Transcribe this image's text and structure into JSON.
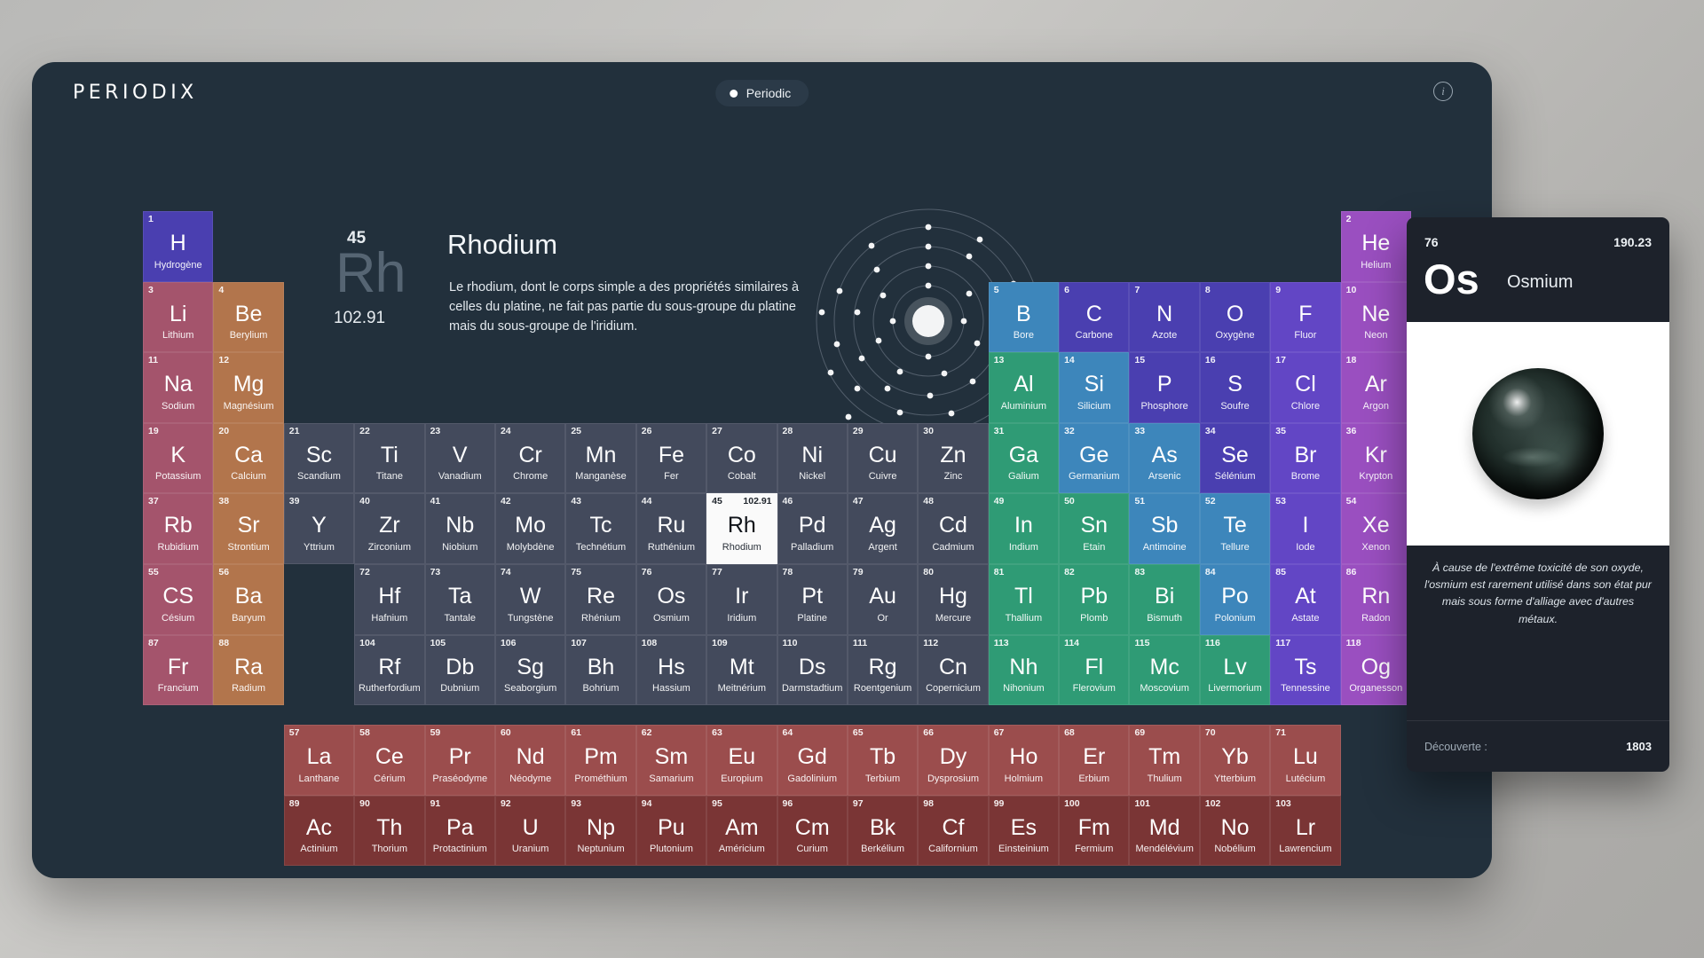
{
  "header": {
    "brand": "PERIODIX",
    "mode_label": "Periodic",
    "info_icon": "info-circle-icon"
  },
  "detail": {
    "number": "45",
    "symbol": "Rh",
    "mass": "102.91",
    "name": "Rhodium",
    "description": "Le rhodium, dont le corps simple a des propriétés similaires à celles du platine, ne fait pas partie du sous-groupe du platine mais du sous-groupe de l'iridium."
  },
  "card": {
    "number": "76",
    "mass": "190.23",
    "symbol": "Os",
    "name": "Osmium",
    "description": "À cause de l'extrême toxicité de son oxyde, l'osmium est rarement utilisé dans son état pur mais sous forme d'alliage avec d'autres métaux.",
    "discovery_label": "Découverte :",
    "discovery_value": "1803",
    "image_alt": "osmium-sphere-photo"
  },
  "colors": {
    "bg_app": "#22303c",
    "alkali": "#a4546c",
    "alkaline_earth": "#b2754c",
    "transition": "#434a5c",
    "post_transition": "#2f9b75",
    "metalloid": "#3d86bb",
    "nonmetal": "#4a3fb0",
    "halogen": "#6246c5",
    "noble": "#9a4fc0",
    "lanthanide": "#9b4d4d",
    "actinide": "#7a3535",
    "selected": "#fafafa"
  },
  "elements": [
    {
      "n": "1",
      "s": "H",
      "name": "Hydrogène",
      "g": "nonmetal",
      "r": 1,
      "c": 1
    },
    {
      "n": "2",
      "s": "He",
      "name": "Helium",
      "g": "noble",
      "r": 1,
      "c": 18
    },
    {
      "n": "3",
      "s": "Li",
      "name": "Lithium",
      "g": "alkali",
      "r": 2,
      "c": 1
    },
    {
      "n": "4",
      "s": "Be",
      "name": "Berylium",
      "g": "alkaline_earth",
      "r": 2,
      "c": 2
    },
    {
      "n": "5",
      "s": "B",
      "name": "Bore",
      "g": "metalloid",
      "r": 2,
      "c": 13
    },
    {
      "n": "6",
      "s": "C",
      "name": "Carbone",
      "g": "nonmetal",
      "r": 2,
      "c": 14
    },
    {
      "n": "7",
      "s": "N",
      "name": "Azote",
      "g": "nonmetal",
      "r": 2,
      "c": 15
    },
    {
      "n": "8",
      "s": "O",
      "name": "Oxygène",
      "g": "nonmetal",
      "r": 2,
      "c": 16
    },
    {
      "n": "9",
      "s": "F",
      "name": "Fluor",
      "g": "halogen",
      "r": 2,
      "c": 17
    },
    {
      "n": "10",
      "s": "Ne",
      "name": "Neon",
      "g": "noble",
      "r": 2,
      "c": 18
    },
    {
      "n": "11",
      "s": "Na",
      "name": "Sodium",
      "g": "alkali",
      "r": 3,
      "c": 1
    },
    {
      "n": "12",
      "s": "Mg",
      "name": "Magnésium",
      "g": "alkaline_earth",
      "r": 3,
      "c": 2
    },
    {
      "n": "13",
      "s": "Al",
      "name": "Aluminium",
      "g": "post_transition",
      "r": 3,
      "c": 13
    },
    {
      "n": "14",
      "s": "Si",
      "name": "Silicium",
      "g": "metalloid",
      "r": 3,
      "c": 14
    },
    {
      "n": "15",
      "s": "P",
      "name": "Phosphore",
      "g": "nonmetal",
      "r": 3,
      "c": 15
    },
    {
      "n": "16",
      "s": "S",
      "name": "Soufre",
      "g": "nonmetal",
      "r": 3,
      "c": 16
    },
    {
      "n": "17",
      "s": "Cl",
      "name": "Chlore",
      "g": "halogen",
      "r": 3,
      "c": 17
    },
    {
      "n": "18",
      "s": "Ar",
      "name": "Argon",
      "g": "noble",
      "r": 3,
      "c": 18
    },
    {
      "n": "19",
      "s": "K",
      "name": "Potassium",
      "g": "alkali",
      "r": 4,
      "c": 1
    },
    {
      "n": "20",
      "s": "Ca",
      "name": "Calcium",
      "g": "alkaline_earth",
      "r": 4,
      "c": 2
    },
    {
      "n": "21",
      "s": "Sc",
      "name": "Scandium",
      "g": "transition",
      "r": 4,
      "c": 3
    },
    {
      "n": "22",
      "s": "Ti",
      "name": "Titane",
      "g": "transition",
      "r": 4,
      "c": 4
    },
    {
      "n": "23",
      "s": "V",
      "name": "Vanadium",
      "g": "transition",
      "r": 4,
      "c": 5
    },
    {
      "n": "24",
      "s": "Cr",
      "name": "Chrome",
      "g": "transition",
      "r": 4,
      "c": 6
    },
    {
      "n": "25",
      "s": "Mn",
      "name": "Manganèse",
      "g": "transition",
      "r": 4,
      "c": 7
    },
    {
      "n": "26",
      "s": "Fe",
      "name": "Fer",
      "g": "transition",
      "r": 4,
      "c": 8
    },
    {
      "n": "27",
      "s": "Co",
      "name": "Cobalt",
      "g": "transition",
      "r": 4,
      "c": 9
    },
    {
      "n": "28",
      "s": "Ni",
      "name": "Nickel",
      "g": "transition",
      "r": 4,
      "c": 10
    },
    {
      "n": "29",
      "s": "Cu",
      "name": "Cuivre",
      "g": "transition",
      "r": 4,
      "c": 11
    },
    {
      "n": "30",
      "s": "Zn",
      "name": "Zinc",
      "g": "transition",
      "r": 4,
      "c": 12
    },
    {
      "n": "31",
      "s": "Ga",
      "name": "Galium",
      "g": "post_transition",
      "r": 4,
      "c": 13
    },
    {
      "n": "32",
      "s": "Ge",
      "name": "Germanium",
      "g": "metalloid",
      "r": 4,
      "c": 14
    },
    {
      "n": "33",
      "s": "As",
      "name": "Arsenic",
      "g": "metalloid",
      "r": 4,
      "c": 15
    },
    {
      "n": "34",
      "s": "Se",
      "name": "Sélénium",
      "g": "nonmetal",
      "r": 4,
      "c": 16
    },
    {
      "n": "35",
      "s": "Br",
      "name": "Brome",
      "g": "halogen",
      "r": 4,
      "c": 17
    },
    {
      "n": "36",
      "s": "Kr",
      "name": "Krypton",
      "g": "noble",
      "r": 4,
      "c": 18
    },
    {
      "n": "37",
      "s": "Rb",
      "name": "Rubidium",
      "g": "alkali",
      "r": 5,
      "c": 1
    },
    {
      "n": "38",
      "s": "Sr",
      "name": "Strontium",
      "g": "alkaline_earth",
      "r": 5,
      "c": 2
    },
    {
      "n": "39",
      "s": "Y",
      "name": "Yttrium",
      "g": "transition",
      "r": 5,
      "c": 3
    },
    {
      "n": "40",
      "s": "Zr",
      "name": "Zirconium",
      "g": "transition",
      "r": 5,
      "c": 4
    },
    {
      "n": "41",
      "s": "Nb",
      "name": "Niobium",
      "g": "transition",
      "r": 5,
      "c": 5
    },
    {
      "n": "42",
      "s": "Mo",
      "name": "Molybdène",
      "g": "transition",
      "r": 5,
      "c": 6
    },
    {
      "n": "43",
      "s": "Tc",
      "name": "Technétium",
      "g": "transition",
      "r": 5,
      "c": 7
    },
    {
      "n": "44",
      "s": "Ru",
      "name": "Ruthénium",
      "g": "transition",
      "r": 5,
      "c": 8
    },
    {
      "n": "45",
      "s": "Rh",
      "name": "Rhodium",
      "g": "transition",
      "r": 5,
      "c": 9,
      "mass": "102.91",
      "selected": true
    },
    {
      "n": "46",
      "s": "Pd",
      "name": "Palladium",
      "g": "transition",
      "r": 5,
      "c": 10
    },
    {
      "n": "47",
      "s": "Ag",
      "name": "Argent",
      "g": "transition",
      "r": 5,
      "c": 11
    },
    {
      "n": "48",
      "s": "Cd",
      "name": "Cadmium",
      "g": "transition",
      "r": 5,
      "c": 12
    },
    {
      "n": "49",
      "s": "In",
      "name": "Indium",
      "g": "post_transition",
      "r": 5,
      "c": 13
    },
    {
      "n": "50",
      "s": "Sn",
      "name": "Etain",
      "g": "post_transition",
      "r": 5,
      "c": 14
    },
    {
      "n": "51",
      "s": "Sb",
      "name": "Antimoine",
      "g": "metalloid",
      "r": 5,
      "c": 15
    },
    {
      "n": "52",
      "s": "Te",
      "name": "Tellure",
      "g": "metalloid",
      "r": 5,
      "c": 16
    },
    {
      "n": "53",
      "s": "I",
      "name": "Iode",
      "g": "halogen",
      "r": 5,
      "c": 17
    },
    {
      "n": "54",
      "s": "Xe",
      "name": "Xenon",
      "g": "noble",
      "r": 5,
      "c": 18
    },
    {
      "n": "55",
      "s": "CS",
      "name": "Césium",
      "g": "alkali",
      "r": 6,
      "c": 1
    },
    {
      "n": "56",
      "s": "Ba",
      "name": "Baryum",
      "g": "alkaline_earth",
      "r": 6,
      "c": 2
    },
    {
      "n": "72",
      "s": "Hf",
      "name": "Hafnium",
      "g": "transition",
      "r": 6,
      "c": 4
    },
    {
      "n": "73",
      "s": "Ta",
      "name": "Tantale",
      "g": "transition",
      "r": 6,
      "c": 5
    },
    {
      "n": "74",
      "s": "W",
      "name": "Tungstène",
      "g": "transition",
      "r": 6,
      "c": 6
    },
    {
      "n": "75",
      "s": "Re",
      "name": "Rhénium",
      "g": "transition",
      "r": 6,
      "c": 7
    },
    {
      "n": "76",
      "s": "Os",
      "name": "Osmium",
      "g": "transition",
      "r": 6,
      "c": 8
    },
    {
      "n": "77",
      "s": "Ir",
      "name": "Iridium",
      "g": "transition",
      "r": 6,
      "c": 9
    },
    {
      "n": "78",
      "s": "Pt",
      "name": "Platine",
      "g": "transition",
      "r": 6,
      "c": 10
    },
    {
      "n": "79",
      "s": "Au",
      "name": "Or",
      "g": "transition",
      "r": 6,
      "c": 11
    },
    {
      "n": "80",
      "s": "Hg",
      "name": "Mercure",
      "g": "transition",
      "r": 6,
      "c": 12
    },
    {
      "n": "81",
      "s": "Tl",
      "name": "Thallium",
      "g": "post_transition",
      "r": 6,
      "c": 13
    },
    {
      "n": "82",
      "s": "Pb",
      "name": "Plomb",
      "g": "post_transition",
      "r": 6,
      "c": 14
    },
    {
      "n": "83",
      "s": "Bi",
      "name": "Bismuth",
      "g": "post_transition",
      "r": 6,
      "c": 15
    },
    {
      "n": "84",
      "s": "Po",
      "name": "Polonium",
      "g": "metalloid",
      "r": 6,
      "c": 16
    },
    {
      "n": "85",
      "s": "At",
      "name": "Astate",
      "g": "halogen",
      "r": 6,
      "c": 17
    },
    {
      "n": "86",
      "s": "Rn",
      "name": "Radon",
      "g": "noble",
      "r": 6,
      "c": 18
    },
    {
      "n": "87",
      "s": "Fr",
      "name": "Francium",
      "g": "alkali",
      "r": 7,
      "c": 1
    },
    {
      "n": "88",
      "s": "Ra",
      "name": "Radium",
      "g": "alkaline_earth",
      "r": 7,
      "c": 2
    },
    {
      "n": "104",
      "s": "Rf",
      "name": "Rutherfordium",
      "g": "transition",
      "r": 7,
      "c": 4
    },
    {
      "n": "105",
      "s": "Db",
      "name": "Dubnium",
      "g": "transition",
      "r": 7,
      "c": 5
    },
    {
      "n": "106",
      "s": "Sg",
      "name": "Seaborgium",
      "g": "transition",
      "r": 7,
      "c": 6
    },
    {
      "n": "107",
      "s": "Bh",
      "name": "Bohrium",
      "g": "transition",
      "r": 7,
      "c": 7
    },
    {
      "n": "108",
      "s": "Hs",
      "name": "Hassium",
      "g": "transition",
      "r": 7,
      "c": 8
    },
    {
      "n": "109",
      "s": "Mt",
      "name": "Meitnérium",
      "g": "transition",
      "r": 7,
      "c": 9
    },
    {
      "n": "110",
      "s": "Ds",
      "name": "Darmstadtium",
      "g": "transition",
      "r": 7,
      "c": 10
    },
    {
      "n": "111",
      "s": "Rg",
      "name": "Roentgenium",
      "g": "transition",
      "r": 7,
      "c": 11
    },
    {
      "n": "112",
      "s": "Cn",
      "name": "Copernicium",
      "g": "transition",
      "r": 7,
      "c": 12
    },
    {
      "n": "113",
      "s": "Nh",
      "name": "Nihonium",
      "g": "post_transition",
      "r": 7,
      "c": 13
    },
    {
      "n": "114",
      "s": "Fl",
      "name": "Flerovium",
      "g": "post_transition",
      "r": 7,
      "c": 14
    },
    {
      "n": "115",
      "s": "Mc",
      "name": "Moscovium",
      "g": "post_transition",
      "r": 7,
      "c": 15
    },
    {
      "n": "116",
      "s": "Lv",
      "name": "Livermorium",
      "g": "post_transition",
      "r": 7,
      "c": 16
    },
    {
      "n": "117",
      "s": "Ts",
      "name": "Tennessine",
      "g": "halogen",
      "r": 7,
      "c": 17
    },
    {
      "n": "118",
      "s": "Og",
      "name": "Organesson",
      "g": "noble",
      "r": 7,
      "c": 18
    }
  ],
  "lanthanides": [
    {
      "n": "57",
      "s": "La",
      "name": "Lanthane",
      "g": "lanthanide"
    },
    {
      "n": "58",
      "s": "Ce",
      "name": "Cérium",
      "g": "lanthanide"
    },
    {
      "n": "59",
      "s": "Pr",
      "name": "Praséodyme",
      "g": "lanthanide"
    },
    {
      "n": "60",
      "s": "Nd",
      "name": "Néodyme",
      "g": "lanthanide"
    },
    {
      "n": "61",
      "s": "Pm",
      "name": "Prométhium",
      "g": "lanthanide"
    },
    {
      "n": "62",
      "s": "Sm",
      "name": "Samarium",
      "g": "lanthanide"
    },
    {
      "n": "63",
      "s": "Eu",
      "name": "Europium",
      "g": "lanthanide"
    },
    {
      "n": "64",
      "s": "Gd",
      "name": "Gadolinium",
      "g": "lanthanide"
    },
    {
      "n": "65",
      "s": "Tb",
      "name": "Terbium",
      "g": "lanthanide"
    },
    {
      "n": "66",
      "s": "Dy",
      "name": "Dysprosium",
      "g": "lanthanide"
    },
    {
      "n": "67",
      "s": "Ho",
      "name": "Holmium",
      "g": "lanthanide"
    },
    {
      "n": "68",
      "s": "Er",
      "name": "Erbium",
      "g": "lanthanide"
    },
    {
      "n": "69",
      "s": "Tm",
      "name": "Thulium",
      "g": "lanthanide"
    },
    {
      "n": "70",
      "s": "Yb",
      "name": "Ytterbium",
      "g": "lanthanide"
    },
    {
      "n": "71",
      "s": "Lu",
      "name": "Lutécium",
      "g": "lanthanide"
    }
  ],
  "actinides": [
    {
      "n": "89",
      "s": "Ac",
      "name": "Actinium",
      "g": "actinide"
    },
    {
      "n": "90",
      "s": "Th",
      "name": "Thorium",
      "g": "actinide"
    },
    {
      "n": "91",
      "s": "Pa",
      "name": "Protactinium",
      "g": "actinide"
    },
    {
      "n": "92",
      "s": "U",
      "name": "Uranium",
      "g": "actinide"
    },
    {
      "n": "93",
      "s": "Np",
      "name": "Neptunium",
      "g": "actinide"
    },
    {
      "n": "94",
      "s": "Pu",
      "name": "Plutonium",
      "g": "actinide"
    },
    {
      "n": "95",
      "s": "Am",
      "name": "Américium",
      "g": "actinide"
    },
    {
      "n": "96",
      "s": "Cm",
      "name": "Curium",
      "g": "actinide"
    },
    {
      "n": "97",
      "s": "Bk",
      "name": "Berkélium",
      "g": "actinide"
    },
    {
      "n": "98",
      "s": "Cf",
      "name": "Californium",
      "g": "actinide"
    },
    {
      "n": "99",
      "s": "Es",
      "name": "Einsteinium",
      "g": "actinide"
    },
    {
      "n": "100",
      "s": "Fm",
      "name": "Fermium",
      "g": "actinide"
    },
    {
      "n": "101",
      "s": "Md",
      "name": "Mendélévium",
      "g": "actinide"
    },
    {
      "n": "102",
      "s": "No",
      "name": "Nobélium",
      "g": "actinide"
    },
    {
      "n": "103",
      "s": "Lr",
      "name": "Lawrencium",
      "g": "actinide"
    }
  ]
}
